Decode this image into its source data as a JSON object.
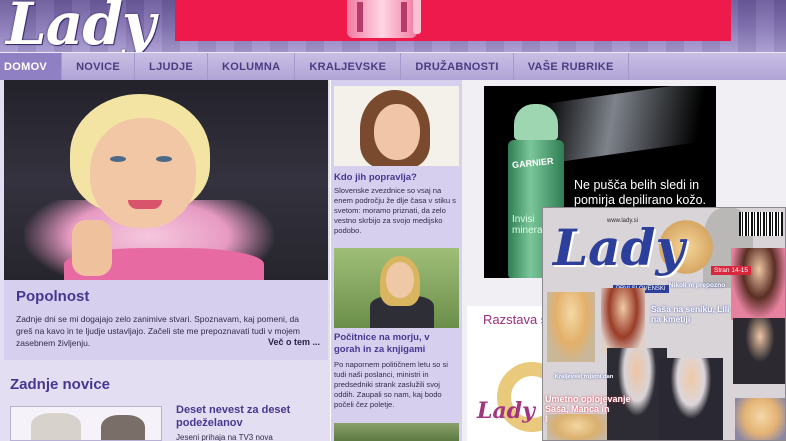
{
  "site": {
    "logo": "Lady"
  },
  "nav": {
    "items": [
      {
        "label": "DOMOV",
        "active": true
      },
      {
        "label": "NOVICE"
      },
      {
        "label": "LJUDJE"
      },
      {
        "label": "KOLUMNA"
      },
      {
        "label": "KRALJEVSKE"
      },
      {
        "label": "DRUŽABNOSTI"
      },
      {
        "label": "VAŠE RUBRIKE"
      }
    ]
  },
  "feature": {
    "title": "Popolnost",
    "text": "Zadnje dni se mi dogajajo zelo zanimive stvari. Spoznavam, kaj pomeni, da greš na kavo in te ljudje ustavljajo. Začeli ste me prepoznavati tudi v mojem zasebnem življenju.",
    "more": "Več o tem ..."
  },
  "latest": {
    "heading": "Zadnje novice",
    "item_title": "Deset nevest za deset podeželanov",
    "item_text": "Jeseni prihaja na TV3 nova"
  },
  "sidebar_articles": [
    {
      "title": "Kdo jih popravlja?",
      "text": "Slovenske zvezdnice so vsaj na enem področju že dlje časa v stiku s svetom: moramo priznati, da zelo vestno skrbijo za svojo medijsko podobo."
    },
    {
      "title": "Počitnice na morju, v gorah in za knjigami",
      "text": "Po napornem političnem letu so si tudi naši poslanci, ministri in predsedniki strank zaslužili svoj oddih. Zaupali so nam, kaj bodo počeli čez poletje."
    }
  ],
  "ads": {
    "garnier": {
      "brand": "GARNIER",
      "sub": "Invisi mineral",
      "tagline": "Ne pušča belih sledi in pomirja depilirano kožo."
    },
    "razstava": {
      "title": "Razstava slovenskih",
      "logo": "Lady"
    }
  },
  "magazine": {
    "logo": "Lady",
    "site": "www.lady.si",
    "tag": "PRVI SLOVENSKI",
    "stran1": "Stran 14-15",
    "headline": "Nikoli ni prepozno",
    "headline2": "Saša na seniku, Lili na kmetiji",
    "bottom1": "Kraljevski rojstni dan",
    "bottom2": "Umetno oplojevanje Saša, Manca in Natalija"
  },
  "colors": {
    "nav_text": "#4b3c82",
    "heading": "#463890",
    "top_ad": "#ee1a4c",
    "panel": "#d7cfee"
  }
}
